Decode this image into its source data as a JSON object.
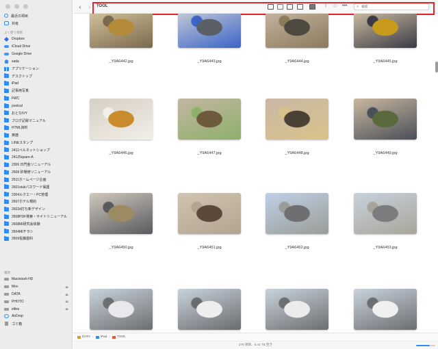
{
  "sidebar": {
    "favorites": [
      {
        "label": "最近の項目",
        "icon": "clock-icon",
        "ico": "ico-circle"
      },
      {
        "label": "共有",
        "icon": "shared-icon",
        "ico": "ico-people"
      }
    ],
    "cloud_head": "よく使う項目",
    "cloud": [
      {
        "label": "Dropbox",
        "icon": "dropbox-icon",
        "ico": "ico-dropbox"
      },
      {
        "label": "iCloud Drive",
        "icon": "icloud-icon",
        "ico": "ico-cloud"
      },
      {
        "label": "Google Drive",
        "icon": "google-drive-icon",
        "ico": "ico-cloud"
      },
      {
        "label": "sada",
        "icon": "home-icon",
        "ico": "ico-home"
      },
      {
        "label": "アプリケーション",
        "icon": "applications-icon",
        "ico": "ico-grid"
      },
      {
        "label": "デスクトップ",
        "icon": "desktop-icon",
        "ico": "ico-folder"
      },
      {
        "label": "iPad",
        "icon": "folder-icon",
        "ico": "ico-folder"
      },
      {
        "label": "記事用写真",
        "icon": "folder-icon",
        "ico": "ico-folder"
      },
      {
        "label": "FWC",
        "icon": "folder-icon",
        "ico": "ico-folder"
      },
      {
        "label": "postcal",
        "icon": "folder-icon",
        "ico": "ico-folder"
      },
      {
        "label": "おとなIVY",
        "icon": "folder-icon",
        "ico": "ico-folder"
      },
      {
        "label": "ブログ記録マニュアル",
        "icon": "folder-icon",
        "ico": "ico-folder"
      },
      {
        "label": "HTML資料",
        "icon": "folder-icon",
        "ico": "ico-folder"
      },
      {
        "label": "楽譜",
        "icon": "folder-icon",
        "ico": "ico-folder"
      },
      {
        "label": "LINEスタンプ",
        "icon": "folder-icon",
        "ico": "ico-folder"
      },
      {
        "label": "2411ペルネットショップ",
        "icon": "folder-icon",
        "ico": "ico-folder"
      },
      {
        "label": "24125quare-A",
        "icon": "folder-icon",
        "ico": "ico-folder"
      },
      {
        "label": "2306 日門金リニューアル",
        "icon": "folder-icon",
        "ico": "ico-folder"
      },
      {
        "label": "2508 砂場修リニューアル",
        "icon": "folder-icon",
        "ico": "ico-folder"
      },
      {
        "label": "2511ホームページ企画",
        "icon": "folder-icon",
        "ico": "ico-folder"
      },
      {
        "label": "2601stukパスワード保護",
        "icon": "folder-icon",
        "ico": "ico-folder"
      },
      {
        "label": "2304ルクエー・PC管理",
        "icon": "folder-icon",
        "ico": "ico-folder"
      },
      {
        "label": "2607ホテル規約",
        "icon": "folder-icon",
        "ico": "ico-folder"
      },
      {
        "label": "2602d打ち新デザイン",
        "icon": "folder-icon",
        "ico": "ico-folder"
      },
      {
        "label": "2608PDF検索・サイトリニューアル",
        "icon": "folder-icon",
        "ico": "ico-folder"
      },
      {
        "label": "2608MI研究会体験",
        "icon": "folder-icon",
        "ico": "ico-folder"
      },
      {
        "label": "2604MIチラシ",
        "icon": "folder-icon",
        "ico": "ico-folder"
      },
      {
        "label": "2609佐藤歯科",
        "icon": "folder-icon",
        "ico": "ico-folder"
      }
    ],
    "locations_head": "場所",
    "locations": [
      {
        "label": "Macintosh HD",
        "icon": "hard-drive-icon",
        "ico": "ico-drive",
        "eject": ""
      },
      {
        "label": "Mov",
        "icon": "external-drive-icon",
        "ico": "ico-drive",
        "eject": "⏏"
      },
      {
        "label": "DATA",
        "icon": "external-drive-icon",
        "ico": "ico-drive",
        "eject": "⏏"
      },
      {
        "label": "PHOTO",
        "icon": "external-drive-icon",
        "ico": "ico-drive",
        "eject": "⏏"
      },
      {
        "label": "ellies",
        "icon": "external-drive-icon",
        "ico": "ico-drive",
        "eject": "⏏"
      },
      {
        "label": "AirDrop",
        "icon": "airdrop-icon",
        "ico": "ico-air",
        "eject": ""
      },
      {
        "label": "ゴミ箱",
        "icon": "trash-icon",
        "ico": "ico-trash",
        "eject": ""
      }
    ]
  },
  "toolbar": {
    "back": "‹",
    "forward": "›",
    "title": "TOOL",
    "search_placeholder": "検索",
    "more": "•••"
  },
  "files": [
    {
      "name": "_Y9A6442.jpg",
      "palette": [
        "#d9c9a3",
        "#b38b3a",
        "#7a6a4c"
      ]
    },
    {
      "name": "_Y9A6443.jpg",
      "palette": [
        "#cfd2d6",
        "#5b5f66",
        "#3b63c8"
      ]
    },
    {
      "name": "_Y9A6444.jpg",
      "palette": [
        "#c9b9a6",
        "#4f4a40",
        "#8c7a5c"
      ]
    },
    {
      "name": "_Y9A6445.jpg",
      "palette": [
        "#d8c7a8",
        "#c79a1c",
        "#3a3a46"
      ]
    },
    {
      "name": "_Y9A6446.jpg",
      "palette": [
        "#d6cfc4",
        "#c98b2b",
        "#f2efe9"
      ]
    },
    {
      "name": "_Y9A6447.jpg",
      "palette": [
        "#c4b6a3",
        "#6e5a3d",
        "#8db06a"
      ]
    },
    {
      "name": "_Y9A6448.jpg",
      "palette": [
        "#c9b8a6",
        "#4a4034",
        "#d9c28a"
      ]
    },
    {
      "name": "_Y9A6449.jpg",
      "palette": [
        "#c8b79f",
        "#5b6a3c",
        "#4a4f58"
      ]
    },
    {
      "name": "_Y9A6450.jpg",
      "palette": [
        "#cfc8bd",
        "#9c8b62",
        "#595a5e"
      ]
    },
    {
      "name": "_Y9A6451.jpg",
      "palette": [
        "#d0c4b2",
        "#5b4a3c",
        "#b2a590"
      ]
    },
    {
      "name": "_Y9A6452.jpg",
      "palette": [
        "#bfd0e6",
        "#6f6f72",
        "#9b9d98"
      ]
    },
    {
      "name": "_Y9A6453.jpg",
      "palette": [
        "#c8d1db",
        "#7a7c7e",
        "#a8a69b"
      ]
    },
    {
      "name": "",
      "palette": [
        "#c9d3dd",
        "#e9e9ec",
        "#6c6f70"
      ]
    },
    {
      "name": "",
      "palette": [
        "#c9d3dd",
        "#eeeeef",
        "#6a6c6e"
      ]
    },
    {
      "name": "",
      "palette": [
        "#c9d3dd",
        "#ececec",
        "#6d6f70"
      ]
    },
    {
      "name": "",
      "palette": [
        "#c9d3dd",
        "#f0f0f0",
        "#6c6e70"
      ]
    }
  ],
  "pathbar": {
    "crumbs": [
      {
        "label": "DATA",
        "color": "#d99b2b"
      },
      {
        "label": "iPad",
        "color": "#2f8cf6"
      },
      {
        "label": "TOOL",
        "color": "#e05a3a"
      }
    ],
    "separator": "›"
  },
  "status": {
    "text": "378 項目、6.44 TB 空き",
    "zoom_fraction": 0.7
  }
}
